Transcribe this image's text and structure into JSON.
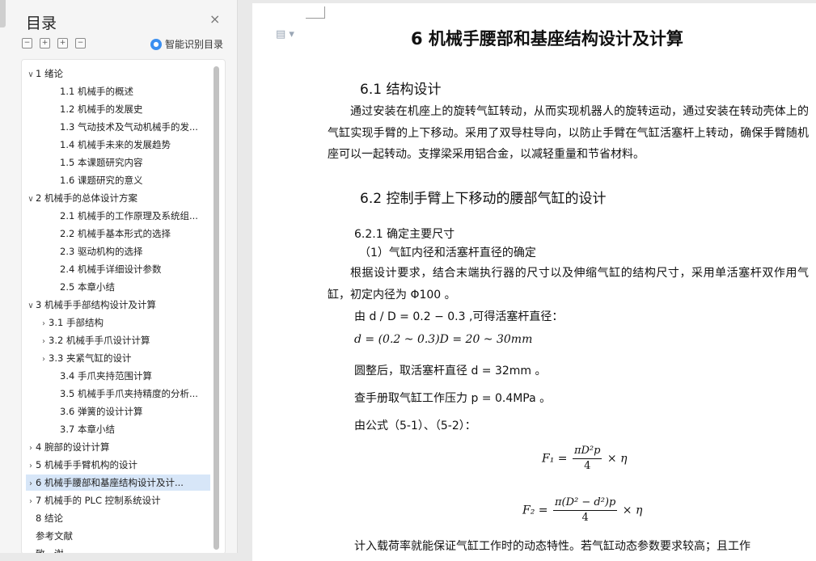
{
  "nav": {
    "title": "目录",
    "close_icon": "×",
    "tools": [
      "−",
      "+",
      "+",
      "−"
    ],
    "smart_label": "智能识别目录",
    "items": [
      {
        "label": "1 绪论",
        "expanded": true
      },
      {
        "label": "1.1 机械手的概述"
      },
      {
        "label": "1.2 机械手的发展史"
      },
      {
        "label": "1.3 气动技术及气动机械手的发..."
      },
      {
        "label": "1.4 机械手未来的发展趋势"
      },
      {
        "label": "1.5 本课题研究内容"
      },
      {
        "label": "1.6 课题研究的意义"
      },
      {
        "label": "2 机械手的总体设计方案",
        "expanded": true
      },
      {
        "label": "2.1 机械手的工作原理及系统组..."
      },
      {
        "label": "2.2 机械手基本形式的选择"
      },
      {
        "label": "2.3 驱动机构的选择"
      },
      {
        "label": "2.4 机械手详细设计参数"
      },
      {
        "label": "2.5 本章小结"
      },
      {
        "label": "3 机械手手部结构设计及计算",
        "expanded": true
      },
      {
        "label": "3.1 手部结构"
      },
      {
        "label": "3.2 机械手手爪设计计算"
      },
      {
        "label": "3.3 夹紧气缸的设计"
      },
      {
        "label": "3.4 手爪夹持范围计算"
      },
      {
        "label": "3.5 机械手手爪夹持精度的分析..."
      },
      {
        "label": "3.6 弹簧的设计计算"
      },
      {
        "label": "3.7 本章小结"
      },
      {
        "label": "4 腕部的设计计算"
      },
      {
        "label": "5 机械手手臂机构的设计"
      },
      {
        "label": "6 机械手腰部和基座结构设计及计...",
        "selected": true
      },
      {
        "label": "7 机械手的 PLC 控制系统设计"
      },
      {
        "label": "8 结论"
      },
      {
        "label": "参考文献"
      },
      {
        "label": "致　谢"
      }
    ]
  },
  "doc": {
    "title": "6  机械手腰部和基座结构设计及计算",
    "h61": "6.1  结构设计",
    "p1": "通过安装在机座上的旋转气缸转动，从而实现机器人的旋转运动，通过安装在转动壳体上的气缸实现手臂的上下移动。采用了双导柱导向，以防止手臂在气缸活塞杆上转动，确保手臂随机座可以一起转动。支撑梁采用铝合金，以减轻重量和节省材料。",
    "h62": "6.2  控制手臂上下移动的腰部气缸的设计",
    "h621": "6.2.1  确定主要尺寸",
    "s1": "（1）气缸内径和活塞杆直径的确定",
    "p2": "根据设计要求，结合末端执行器的尺寸以及伸缩气缸的结构尺寸，采用单活塞杆双作用气缸，初定内径为 Φ100 。",
    "l1": "由 d / D = 0.2 − 0.3 ,可得活塞杆直径：",
    "eq1": "d = (0.2 ~ 0.3)D = 20 ~ 30mm",
    "l2": "圆整后，取活塞杆直径  d = 32mm 。",
    "l3": "查手册取气缸工作压力 p = 0.4MPa 。",
    "l4": "由公式（5-1）、（5-2）：",
    "f1_lhs": "F₁ =",
    "f1_num": "πD²p",
    "f1_den": "4",
    "f1_tail": "× η",
    "f2_lhs": "F₂ =",
    "f2_num": "π(D² − d²)p",
    "f2_den": "4",
    "f2_tail": "× η",
    "p3": "计入载荷率就能保证气缸工作时的动态特性。若气缸动态参数要求较高；且工作"
  }
}
